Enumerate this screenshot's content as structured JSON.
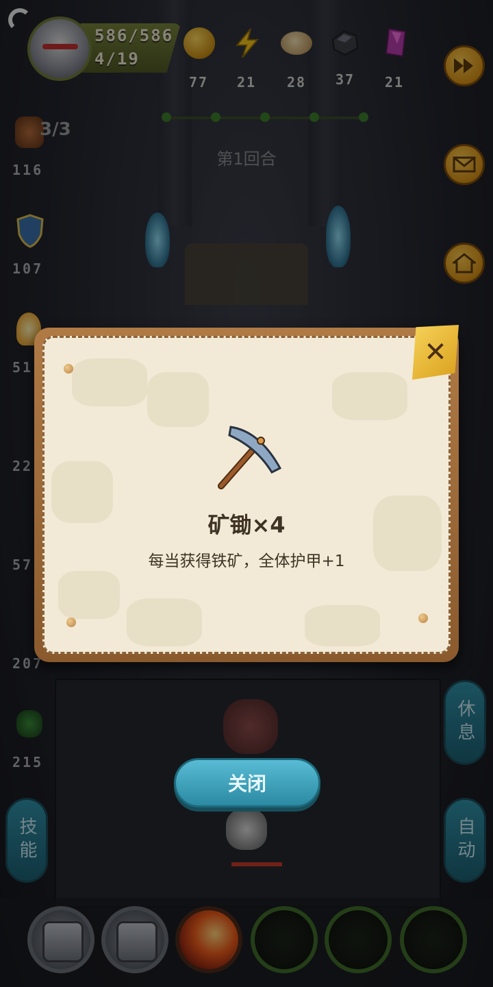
{
  "hud": {
    "hp": "586/586",
    "floor": "4/19",
    "resources": [
      {
        "icon": "gold-coin-icon",
        "value": "77"
      },
      {
        "icon": "energy-bolt-icon",
        "value": "21"
      },
      {
        "icon": "bread-icon",
        "value": "28"
      },
      {
        "icon": "iron-ore-icon",
        "value": "37"
      },
      {
        "icon": "crystal-icon",
        "value": "21"
      }
    ]
  },
  "round": {
    "label": "第1回合",
    "attempts": "3/3"
  },
  "stats": [
    {
      "icon": "fist-icon",
      "value": "116"
    },
    {
      "icon": "shield-icon",
      "value": "107"
    },
    {
      "icon": "flame-icon",
      "value": "51"
    },
    {
      "icon": "skull-icon",
      "value": "22"
    },
    {
      "icon": "fire-icon",
      "value": "57"
    },
    {
      "icon": "purple-icon",
      "value": "207"
    },
    {
      "icon": "leaf-icon",
      "value": "215"
    }
  ],
  "side_buttons": {
    "rest": "休息",
    "skill": "技能",
    "auto": "自动"
  },
  "dialog": {
    "title": "矿锄×4",
    "description": "每当获得铁矿，全体护甲+1",
    "close_button": "关闭"
  },
  "bottom_slots": [
    "chest-icon",
    "chest-icon",
    "fire-slash-icon",
    "empty",
    "empty",
    "empty"
  ]
}
